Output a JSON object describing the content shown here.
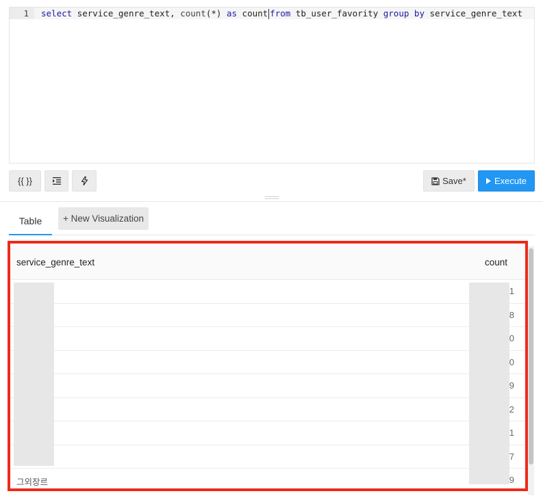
{
  "editor": {
    "line_number": "1",
    "tokens": {
      "kw_select": "select",
      "col1": " service_genre_text, ",
      "fn_count": "count",
      "star": "(*) ",
      "kw_as": "as",
      "alias": " count",
      "kw_from": "from",
      "table": " tb_user_favority ",
      "kw_group": "group",
      "sp": " ",
      "kw_by": "by",
      "groupcol": " service_genre_text"
    }
  },
  "toolbar": {
    "params_label": "{{ }}",
    "save_label": "Save*",
    "execute_label": "Execute"
  },
  "tabs": {
    "table_label": "Table",
    "new_viz_label": "+ New Visualization"
  },
  "results": {
    "columns": [
      "service_genre_text",
      "count"
    ],
    "rows": [
      {
        "name": "",
        "count": "1"
      },
      {
        "name": "",
        "count": "8"
      },
      {
        "name": "",
        "count": "0"
      },
      {
        "name": "",
        "count": "0"
      },
      {
        "name": "",
        "count": "9"
      },
      {
        "name": "",
        "count": "2"
      },
      {
        "name": "",
        "count": "1"
      },
      {
        "name": "",
        "count": "7"
      },
      {
        "name": "그외장르",
        "count": "9"
      }
    ]
  },
  "colors": {
    "accent": "#2196f3",
    "highlight": "#ee2a1a"
  }
}
